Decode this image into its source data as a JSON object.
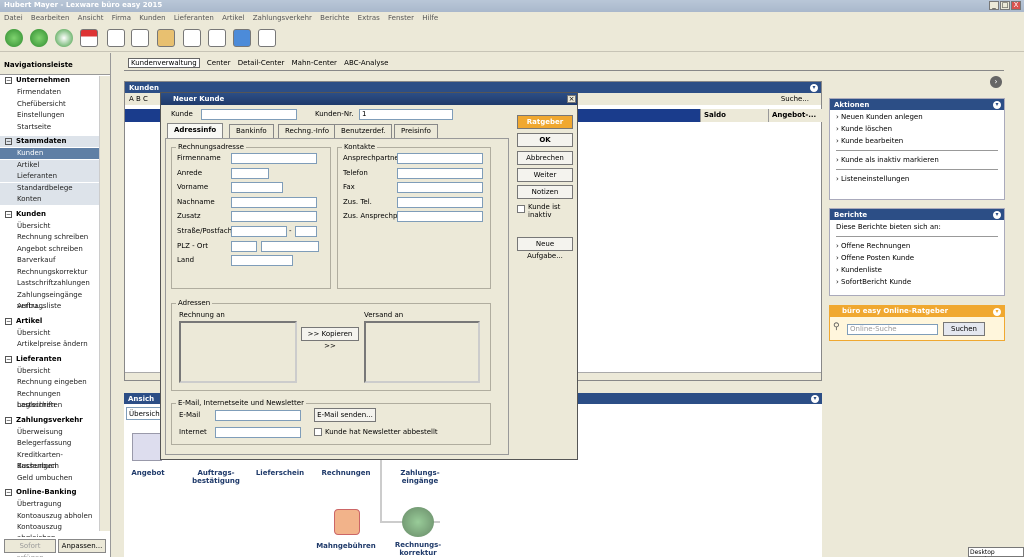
{
  "window": {
    "title": "Hubert Mayer - Lexware büro easy 2015",
    "min": "_",
    "max": "□",
    "close": "X"
  },
  "menu": [
    "Datei",
    "Bearbeiten",
    "Ansicht",
    "Firma",
    "Kunden",
    "Lieferanten",
    "Artikel",
    "Zahlungsverkehr",
    "Berichte",
    "Extras",
    "Fenster",
    "Hilfe"
  ],
  "nav": {
    "title": "Navigationsleiste",
    "groups": [
      {
        "name": "Unternehmen",
        "items": [
          "Firmendaten",
          "Chefübersicht",
          "Einstellungen",
          "Startseite"
        ]
      },
      {
        "name": "Stammdaten",
        "items": [
          "Kunden",
          "Artikel",
          "Lieferanten",
          "Standardbelege",
          "Konten"
        ]
      },
      {
        "name": "Kunden",
        "items": [
          "Übersicht",
          "Rechnung schreiben",
          "Angebot schreiben",
          "Barverkauf",
          "Rechnungskorrektur",
          "Lastschriftzahlungen",
          "Zahlungseingänge verbu...",
          "Auftragsliste"
        ]
      },
      {
        "name": "Artikel",
        "items": [
          "Übersicht",
          "Artikelpreise ändern"
        ]
      },
      {
        "name": "Lieferanten",
        "items": [
          "Übersicht",
          "Rechnung eingeben",
          "Rechnungen begleichen",
          "Lastschriften"
        ]
      },
      {
        "name": "Zahlungsverkehr",
        "items": [
          "Überweisung",
          "Belegerfassung",
          "Kreditkarten-Buchungen",
          "Kassenbuch",
          "Geld umbuchen"
        ]
      },
      {
        "name": "Online-Banking",
        "items": [
          "Übertragung",
          "Kontoauszug abholen",
          "Kontoauszug abgleichen"
        ]
      }
    ],
    "btn_sofort": "Sofort erfügen",
    "btn_anpassen": "Anpassen..."
  },
  "tabs": [
    "Kundenverwaltung",
    "Center",
    "Detail-Center",
    "Mahn-Center",
    "ABC-Analyse"
  ],
  "main": {
    "title": "Kunden",
    "letters": "A B C",
    "search": "Suche...",
    "col_saldo": "Saldo",
    "col_angebot": "Angebot-...",
    "ansicht": "Ansich",
    "uebersicht": "Übersich"
  },
  "icons": [
    "Angebot",
    "Auftrags-bestätigung",
    "Lieferschein",
    "Rechnungen",
    "Zahlungs-eingänge",
    "Mahngebühren",
    "Rechnungs-korrektur"
  ],
  "aktionen": {
    "title": "Aktionen",
    "items": [
      "Neuen Kunden anlegen",
      "Kunde löschen",
      "Kunde bearbeiten",
      "Kunde als inaktiv markieren",
      "Listeneinstellungen"
    ]
  },
  "berichte": {
    "title": "Berichte",
    "intro": "Diese Berichte bieten sich an:",
    "items": [
      "Offene Rechnungen",
      "Offene Posten Kunde",
      "Kundenliste",
      "SofortBericht Kunde"
    ]
  },
  "ratgeber": {
    "title": "büro easy Online-Ratgeber",
    "placeholder": "Online-Suche",
    "button": "Suchen"
  },
  "dialog": {
    "title": "Neuer Kunde",
    "kunde_label": "Kunde",
    "kundennr_label": "Kunden-Nr.",
    "kundennr": "1",
    "tabs": [
      "Adressinfo",
      "Bankinfo",
      "Rechng.-Info",
      "Benutzerdef.",
      "Preisinfo"
    ],
    "rechnungsadresse": "Rechnungsadresse",
    "addr_fields": [
      "Firmenname",
      "Anrede",
      "Vorname",
      "Nachname",
      "Zusatz",
      "Straße/Postfach",
      "PLZ - Ort",
      "Land"
    ],
    "kontakte": "Kontakte",
    "contact_fields": [
      "Ansprechpartner",
      "Telefon",
      "Fax",
      "Zus. Tel.",
      "Zus. Ansprechp."
    ],
    "adressen": "Adressen",
    "rechnung_an": "Rechnung an",
    "versand_an": "Versand an",
    "kopieren": ">> Kopieren >>",
    "email_group": "E-Mail, Internetseite und Newsletter",
    "email": "E-Mail",
    "internet": "Internet",
    "email_send": "E-Mail senden...",
    "newsletter": "Kunde hat Newsletter abbestellt",
    "buttons": {
      "ratgeber": "Ratgeber",
      "ok": "OK",
      "abbrechen": "Abbrechen",
      "weiter": "Weiter",
      "notizen": "Notizen",
      "neue_aufgabe": "Neue Aufgabe..."
    },
    "inaktiv": "Kunde ist inaktiv"
  },
  "desktop": "Desktop anzeigen"
}
